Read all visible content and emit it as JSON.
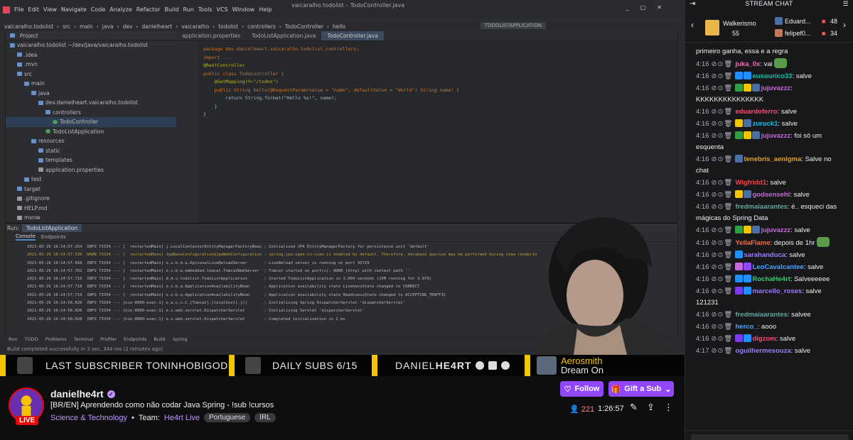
{
  "ide": {
    "menu": [
      "File",
      "Edit",
      "View",
      "Navigate",
      "Code",
      "Analyze",
      "Refactor",
      "Build",
      "Run",
      "Tools",
      "VCS",
      "Window",
      "Help"
    ],
    "window_title": "vaicaralho.todolist – TodoController.java",
    "breadcrumb": [
      "vaicaralho.todolist",
      "src",
      "main",
      "java",
      "dev",
      "danielheart",
      "vaicaralho",
      "todolist",
      "controllers",
      "TodoController",
      "hello"
    ],
    "run_config": "TODOLISTAPPLICATION",
    "project_header": "Project",
    "tree": [
      {
        "label": "vaicaralho.todolist ~/dev/java/vaicaralho.todolist",
        "indent": 0,
        "kind": "folder"
      },
      {
        "label": ".idea",
        "indent": 1,
        "kind": "folder"
      },
      {
        "label": ".mvn",
        "indent": 1,
        "kind": "folder"
      },
      {
        "label": "src",
        "indent": 1,
        "kind": "folder"
      },
      {
        "label": "main",
        "indent": 2,
        "kind": "folder"
      },
      {
        "label": "java",
        "indent": 3,
        "kind": "folder"
      },
      {
        "label": "dev.danielheart.vaicaralho.todolist",
        "indent": 4,
        "kind": "folder"
      },
      {
        "label": "controllers",
        "indent": 5,
        "kind": "folder"
      },
      {
        "label": "TodoController",
        "indent": 6,
        "kind": "file",
        "selected": true
      },
      {
        "label": "TodoListApplication",
        "indent": 5,
        "kind": "file"
      },
      {
        "label": "resources",
        "indent": 3,
        "kind": "folder"
      },
      {
        "label": "static",
        "indent": 4,
        "kind": "folder"
      },
      {
        "label": "templates",
        "indent": 4,
        "kind": "folder"
      },
      {
        "label": "application.properties",
        "indent": 4,
        "kind": "plain"
      },
      {
        "label": "test",
        "indent": 2,
        "kind": "folder"
      },
      {
        "label": "target",
        "indent": 1,
        "kind": "folder"
      },
      {
        "label": ".gitignore",
        "indent": 1,
        "kind": "plain"
      },
      {
        "label": "HELP.md",
        "indent": 1,
        "kind": "plain"
      },
      {
        "label": "mvnw",
        "indent": 1,
        "kind": "plain"
      }
    ],
    "editor_tabs": [
      "application.properties",
      "TodoListApplication.java",
      "TodoController.java"
    ],
    "code_lines": [
      "package dev.danielheart.vaicaralho.todolist.controllers;",
      "",
      "import ...",
      "",
      "@RestController",
      "public class TodoController {",
      "",
      "    @GetMapping(®~\"/todos\")",
      "    public String hello(@RequestParam(value = \"name\", defaultValue = \"World\") String name) {",
      "        return String.format(\"Hello %s!\", name);",
      "    }",
      "}"
    ],
    "run_label": "Run:",
    "run_tab": "TodoListApplication",
    "console_tabs": [
      "Console",
      "Endpoints"
    ],
    "console_lines": [
      "2021-05-29 16:14:57.264  INFO 73334 --- [  restartedMain] j.LocalContainerEntityManagerFactoryBean : Initialized JPA EntityManagerFactory for persistence unit 'default'",
      "2021-05-29 16:14:57.330  WARN 73334 --- [  restartedMain] JpaBaseConfiguration$JpaWebConfiguration : spring.jpa.open-in-view is enabled by default. Therefore, database queries may be performed during view renderin",
      "2021-05-29 16:14:57.669  INFO 73334 --- [  restartedMain] o.s.b.d.a.OptionalLiveReloadServer       : LiveReload server is running on port 35729",
      "2021-05-29 16:14:57.702  INFO 73334 --- [  restartedMain] o.s.b.w.embedded.tomcat.TomcatWebServer  : Tomcat started on port(s): 8080 (http) with context path ''",
      "2021-05-29 16:14:57.716  INFO 73334 --- [  restartedMain] d.d.v.todolist.TodoListApplication       : Started TodoListApplication in 3.004 seconds (JVM running for 3.979)",
      "2021-05-29 16:14:57.718  INFO 73334 --- [  restartedMain] o.s.b.a.ApplicationAvailabilityBean      : Application availability state LivenessState changed to CORRECT",
      "2021-05-29 16:14:57.719  INFO 73334 --- [  restartedMain] o.s.b.a.ApplicationAvailabilityBean      : Application availability state ReadinessState changed to ACCEPTING_TRAFFIC",
      "2021-05-29 16:14:58.026  INFO 73334 --- [nio-8080-exec-1] o.a.c.c.C.[Tomcat].[localhost].[/]       : Initializing Spring DispatcherServlet 'dispatcherServlet'",
      "2021-05-29 16:14:58.026  INFO 73334 --- [nio-8080-exec-1] o.s.web.servlet.DispatcherServlet        : Initializing Servlet 'dispatcherServlet'",
      "2021-05-29 16:14:58.028  INFO 73334 --- [nio-8080-exec-1] o.s.web.servlet.DispatcherServlet        : Completed initialization in 2 ms"
    ],
    "bottom_tabs": [
      "Run",
      "TODO",
      "Problems",
      "Terminal",
      "Profiler",
      "Endpoints",
      "Build",
      "Spring"
    ],
    "status_text": "Build completed successfully in 3 sec, 344 ms (2 minutes ago)"
  },
  "ticker": {
    "last_sub": "LAST SUBSCRIBER TONINHOBIGODE",
    "daily_subs": "DAILY SUBS 6/15",
    "brand_left": "DANIEL",
    "brand_right": "HE4RT",
    "song_artist": "Aerosmith",
    "song_title": "Dream On"
  },
  "channel": {
    "name": "danielhe4rt",
    "live_label": "LIVE",
    "title": "[BR/EN] Aprendendo como não codar Java Spring - !sub !cursos",
    "category": "Science & Technology",
    "team_prefix": "Team:",
    "team": "He4rt Live",
    "tags": [
      "Portuguese",
      "IRL"
    ],
    "follow_label": "Follow",
    "gift_label": "Gift a Sub",
    "viewers": "221",
    "uptime": "1:26:57"
  },
  "chat": {
    "header": "STREAM CHAT",
    "gifters": [
      {
        "name": "Walkerismo",
        "count": "55"
      },
      {
        "name": "Eduard...",
        "count": "48"
      },
      {
        "name": "felipef0...",
        "count": "34"
      }
    ],
    "messages": [
      {
        "ts": "",
        "user": "",
        "color": "#efeff1",
        "text": "primeiro ganha, essa e a regra",
        "badges": []
      },
      {
        "ts": "4:16",
        "user": "juka_0x",
        "color": "#ff69b4",
        "text": "vai",
        "badges": [],
        "emote": true
      },
      {
        "ts": "4:16",
        "user": "eusourico33",
        "color": "#00c8af",
        "text": "salve",
        "badges": [
          "#1e90ff",
          "#1e90ff"
        ]
      },
      {
        "ts": "4:16",
        "user": "jujuvazzz",
        "color": "#c46ad6",
        "text": "KKKKKKKKKKKKKKK",
        "badges": [
          "#2ea043",
          "#f5c400",
          "#4a6fa5"
        ]
      },
      {
        "ts": "4:16",
        "user": "eduardoferro",
        "color": "#ff4a6f",
        "text": "salve",
        "badges": []
      },
      {
        "ts": "4:16",
        "user": "zuruck1",
        "color": "#00c8f0",
        "text": "salve",
        "badges": [
          "#f5c400",
          "#4a6fa5"
        ]
      },
      {
        "ts": "4:16",
        "user": "jujuvazzz",
        "color": "#c46ad6",
        "text": "foi só um esquenta",
        "badges": [
          "#2ea043",
          "#f5c400",
          "#4a6fa5"
        ]
      },
      {
        "ts": "4:16",
        "user": "tenebris_aenigma",
        "color": "#e0a030",
        "text": "Salve no chat",
        "badges": [
          "#4a6fa5"
        ]
      },
      {
        "ts": "4:16",
        "user": "Wigfridd1",
        "color": "#ff4040",
        "text": "salve",
        "badges": []
      },
      {
        "ts": "4:16",
        "user": "godsensehl",
        "color": "#c46ad6",
        "text": "salve",
        "badges": [
          "#f5c400",
          "#4a6fa5"
        ]
      },
      {
        "ts": "4:16",
        "user": "fredmaiaarantes",
        "color": "#5fa8a0",
        "text": "é.. esqueci das mágicas do Spring Data",
        "badges": []
      },
      {
        "ts": "4:16",
        "user": "jujuvazzz",
        "color": "#c46ad6",
        "text": "salve",
        "badges": [
          "#2ea043",
          "#f5c400",
          "#4a6fa5"
        ]
      },
      {
        "ts": "4:16",
        "user": "YellaFlame",
        "color": "#ff6a3d",
        "text": "depois de 1hr",
        "badges": [],
        "emote": true
      },
      {
        "ts": "4:16",
        "user": "sarahanduca",
        "color": "#9b7bff",
        "text": "salve",
        "badges": [
          "#1e90ff"
        ]
      },
      {
        "ts": "4:16",
        "user": "LeoCavalcantee",
        "color": "#4aa3ff",
        "text": "salve",
        "badges": [
          "#c46ad6",
          "#9147ff"
        ]
      },
      {
        "ts": "4:16",
        "user": "RochaHe4rt",
        "color": "#2ecc71",
        "text": "Salveeeeee",
        "badges": [
          "#1e90ff",
          "#1e90ff"
        ]
      },
      {
        "ts": "4:16",
        "user": "marcello_roses",
        "color": "#9b7bff",
        "text": "salve 121231",
        "badges": [
          "#7c3aed",
          "#1e90ff"
        ]
      },
      {
        "ts": "4:16",
        "user": "fredmaiaarantes",
        "color": "#5fa8a0",
        "text": "salvee",
        "badges": []
      },
      {
        "ts": "4:16",
        "user": "herco_",
        "color": "#4aa3ff",
        "text": "aooo",
        "badges": []
      },
      {
        "ts": "4:16",
        "user": "digzom",
        "color": "#ff4a6f",
        "text": "salve",
        "badges": [
          "#7c3aed",
          "#1e90ff"
        ]
      },
      {
        "ts": "4:17",
        "user": "oguilhermesouza",
        "color": "#9b7bff",
        "text": "salve",
        "badges": []
      }
    ]
  },
  "colors": {
    "accent": "#9147ff",
    "live": "#eb0400",
    "ticker_yellow": "#f5c400"
  }
}
